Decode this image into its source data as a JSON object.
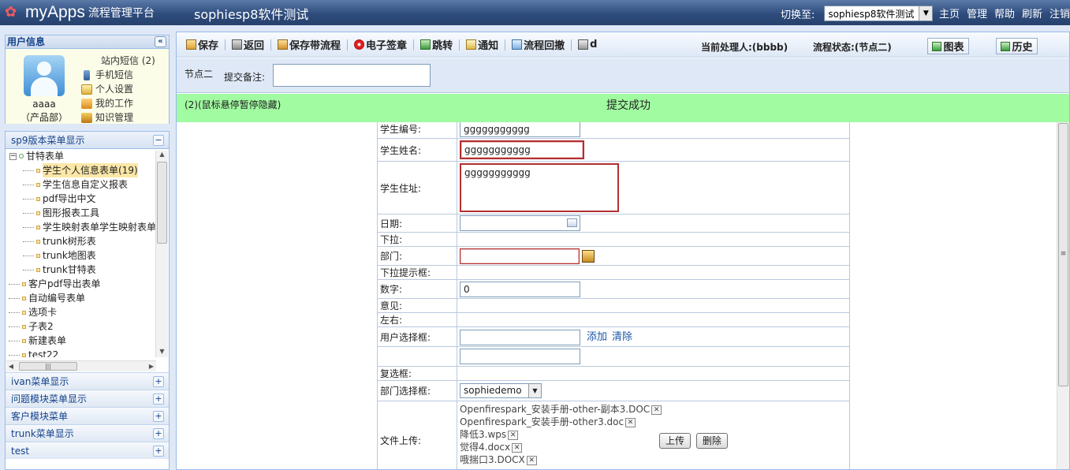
{
  "header": {
    "logo_text": "myApps",
    "logo_sub": "流程管理平台",
    "app_title": "sophiesp8软件测试",
    "switch_label": "切换至:",
    "switch_value": "sophiesp8软件测试",
    "links": [
      "主页",
      "管理",
      "帮助",
      "刷新",
      "注销"
    ]
  },
  "user_panel": {
    "title": "用户信息",
    "name": "aaaa",
    "dept": "（产品部）",
    "messages": "站内短信 (2)",
    "links": [
      "手机短信",
      "个人设置",
      "我的工作",
      "知识管理"
    ]
  },
  "menu": {
    "active_section": "sp9版本菜单显示",
    "tree_root": "甘特表单",
    "tree_children": [
      "学生个人信息表单(19)",
      "学生信息自定义报表",
      "pdf导出中文",
      "图形报表工具",
      "学生映射表单学生映射表单",
      "trunk树形表",
      "trunk地图表",
      "trunk甘特表"
    ],
    "tree_items": [
      "客户pdf导出表单",
      "自动编号表单",
      "选项卡",
      "子表2",
      "新建表单",
      "test22"
    ],
    "sections": [
      "ivan菜单显示",
      "问题模块菜单显示",
      "客户模块菜单",
      "trunk菜单显示",
      "test"
    ]
  },
  "toolbar": {
    "save": "保存",
    "back": "返回",
    "save_flow": "保存带流程",
    "sign": "电子签章",
    "jump": "跳转",
    "notify": "通知",
    "rollback": "流程回撤",
    "print": "d",
    "handler": "当前处理人:(bbbb)",
    "status": "流程状态:(节点二)",
    "chart": "图表",
    "history": "历史"
  },
  "node": {
    "name": "节点二",
    "remark_label": "提交备注:",
    "remark_value": ""
  },
  "notice": {
    "hint": "(2)(鼠标悬停暂停隐藏)",
    "message": "提交成功"
  },
  "form": {
    "student_no_label": "学生编号:",
    "student_no": "ggggggggggg",
    "student_name_label": "学生姓名:",
    "student_name": "ggggggggggg",
    "address_label": "学生住址:",
    "address": "ggggggggggg",
    "date_label": "日期:",
    "dropdown_label": "下拉:",
    "dept_label": "部门:",
    "dropdown_hint_label": "下拉提示框:",
    "number_label": "数字:",
    "number_value": "0",
    "opinion_label": "意见:",
    "leftright_label": "左右:",
    "user_select_label": "用户选择框:",
    "add_link": "添加",
    "clear_link": "清除",
    "checkbox_label": "复选框:",
    "dept_select_label": "部门选择框:",
    "dept_select_value": "sophiedemo",
    "upload_label": "文件上传:",
    "files": [
      "Openfirespark_安装手册-other-副本3.DOC",
      "Openfirespark_安装手册-other3.doc",
      "降低3.wps",
      "觉得4.docx",
      "哦揣口3.DOCX"
    ],
    "upload_button": "上传",
    "delete_button": "删除"
  }
}
